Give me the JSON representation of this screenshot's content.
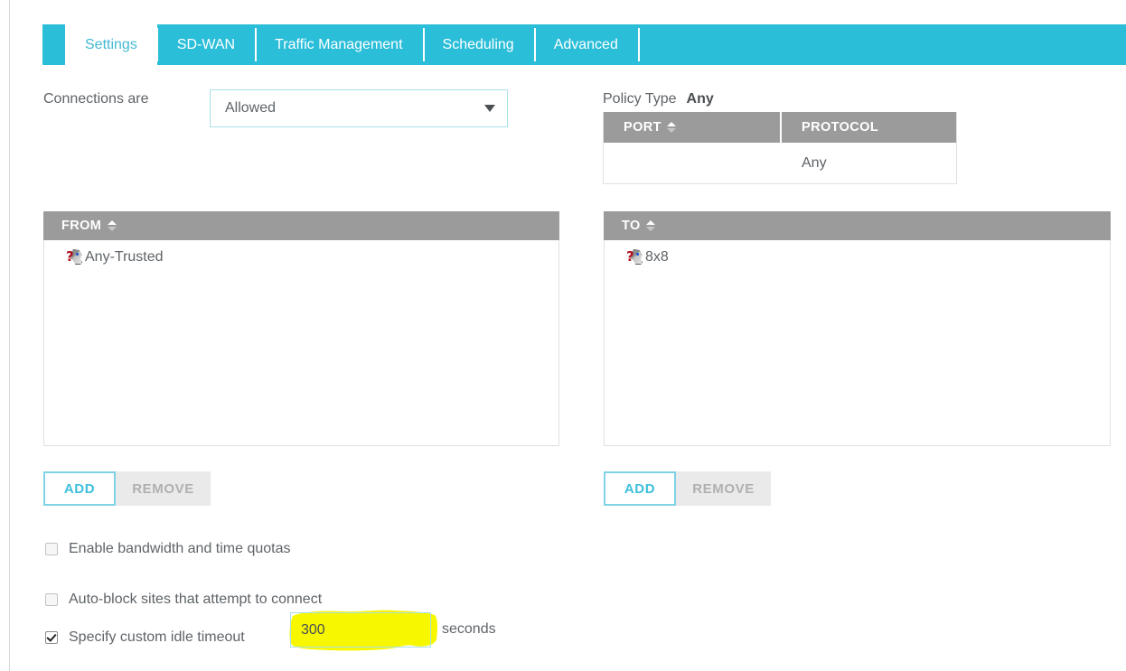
{
  "tabs": [
    {
      "label": "Settings",
      "active": true
    },
    {
      "label": "SD-WAN",
      "active": false
    },
    {
      "label": "Traffic Management",
      "active": false
    },
    {
      "label": "Scheduling",
      "active": false
    },
    {
      "label": "Advanced",
      "active": false
    }
  ],
  "connections": {
    "label": "Connections are",
    "selected": "Allowed",
    "caret_icon": "chevron-down-icon"
  },
  "policy": {
    "label": "Policy Type",
    "value": "Any"
  },
  "port_table": {
    "headers": [
      "PORT",
      "PROTOCOL"
    ],
    "rows": [
      {
        "port": "",
        "protocol": "Any"
      }
    ]
  },
  "from_panel": {
    "title": "FROM",
    "items": [
      {
        "label": "Any-Trusted",
        "icon": "unknown-host-icon"
      }
    ],
    "add_label": "ADD",
    "remove_label": "REMOVE"
  },
  "to_panel": {
    "title": "TO",
    "items": [
      {
        "label": "8x8",
        "icon": "unknown-host-icon"
      }
    ],
    "add_label": "ADD",
    "remove_label": "REMOVE"
  },
  "options": {
    "quota": {
      "label": "Enable bandwidth and time quotas",
      "checked": false
    },
    "autoblock": {
      "label": "Auto-block sites that attempt to connect",
      "checked": false
    },
    "idle": {
      "label": "Specify custom idle timeout",
      "checked": true
    },
    "idle_value": "300",
    "idle_units": "seconds"
  },
  "colors": {
    "accent_cyan": "#2bbed8",
    "tab_active_text": "#42b9d4",
    "table_header_gray": "#9b9b9b",
    "border_light_cyan": "#a9dfe9",
    "text_gray": "#5f6468",
    "highlight_yellow": "#f7f700"
  }
}
